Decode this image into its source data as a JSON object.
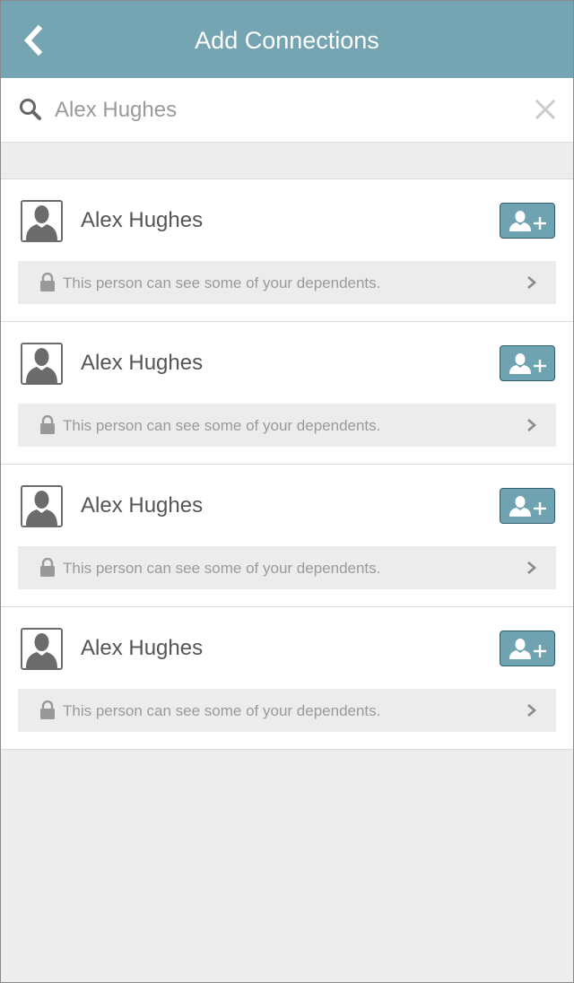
{
  "header": {
    "title": "Add Connections",
    "color": "#75a5b2"
  },
  "search": {
    "value": "",
    "placeholder": "Alex Hughes"
  },
  "connections": [
    {
      "name": "Alex Hughes",
      "info": "This person can see some of your dependents."
    },
    {
      "name": "Alex Hughes",
      "info": "This person can see some of your dependents."
    },
    {
      "name": "Alex Hughes",
      "info": "This person can see some of your dependents."
    },
    {
      "name": "Alex Hughes",
      "info": "This person can see some of your dependents."
    }
  ],
  "icons": {
    "back": "chevron-left-icon",
    "search": "search-icon",
    "clear": "close-icon",
    "avatar": "person-silhouette-icon",
    "add": "add-user-icon",
    "lock": "lock-icon",
    "chevron": "chevron-right-icon"
  },
  "colors": {
    "accent": "#75a5b2",
    "button": "#6fa3b1",
    "background": "#ededed"
  }
}
